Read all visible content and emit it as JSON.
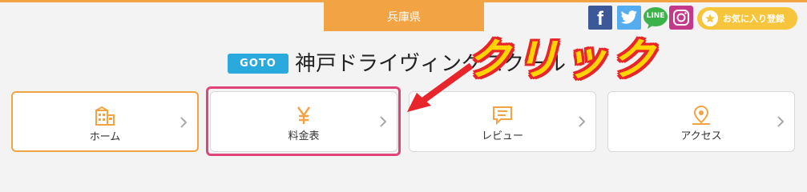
{
  "header": {
    "prefecture": "兵庫県",
    "social": {
      "facebook_glyph": "f",
      "line_glyph": "LINE"
    },
    "favorite_label": "お気に入り登録"
  },
  "school": {
    "badge": "GOTO",
    "name": "神戸ドライヴィングスクール"
  },
  "nav": {
    "items": [
      {
        "label": "ホーム",
        "icon": "building-icon"
      },
      {
        "label": "料金表",
        "icon": "yen-icon"
      },
      {
        "label": "レビュー",
        "icon": "speech-bubble-icon"
      },
      {
        "label": "アクセス",
        "icon": "map-pin-icon"
      }
    ]
  },
  "annotation": {
    "click_text": "クリック"
  },
  "colors": {
    "accent": "#f2a444",
    "badge": "#2aa9dc",
    "highlight": "#e0457a",
    "favorite": "#f7c53c"
  }
}
